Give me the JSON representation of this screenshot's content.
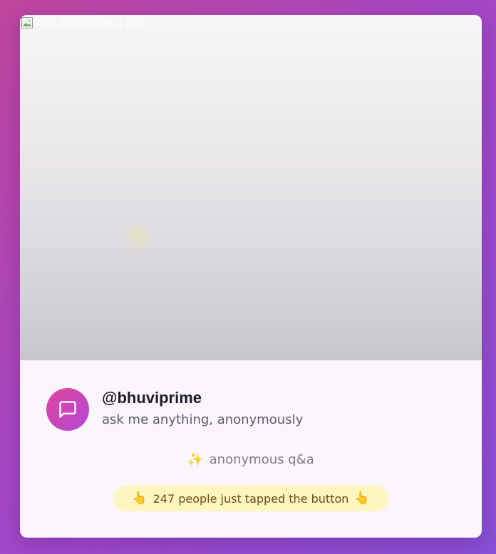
{
  "hero": {
    "image_alt": "Ask Anonymous Me"
  },
  "profile": {
    "username": "@bhuviprime",
    "tagline": "ask me anything, anonymously",
    "avatar_icon": "message-square-icon"
  },
  "category": {
    "icon": "✨",
    "label": "anonymous q&a"
  },
  "social_proof": {
    "left_icon": "👆",
    "text": "247 people just tapped the button",
    "right_icon": "👆"
  },
  "colors": {
    "background_start": "#c0469e",
    "background_end": "#8a4fd6",
    "card": "#fbf6fb",
    "avatar_start": "#e0469c",
    "avatar_end": "#b348d8",
    "pill": "#fff5c0"
  }
}
